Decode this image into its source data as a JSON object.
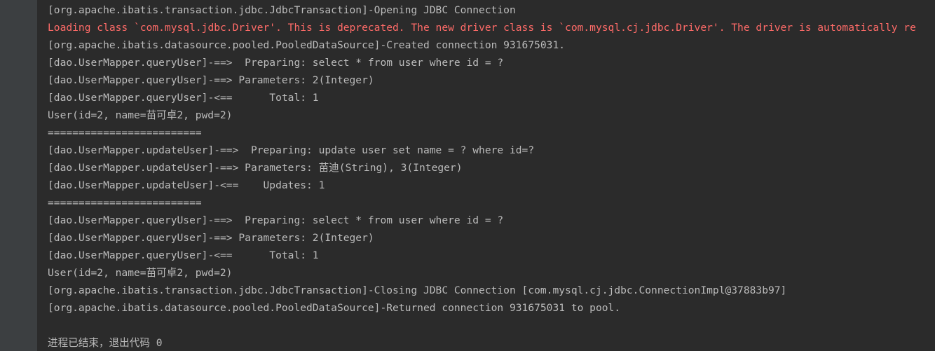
{
  "console": {
    "background_color": "#2b2b2b",
    "gutter_color": "#3c3f41",
    "info_color": "#bbbbbb",
    "error_color": "#ff6b68",
    "lines": [
      {
        "id": "line-opening-jdbc-connection",
        "type": "info",
        "text": "[org.apache.ibatis.transaction.jdbc.JdbcTransaction]-Opening JDBC Connection"
      },
      {
        "id": "line-driver-deprecated-warning",
        "type": "error",
        "text": "Loading class `com.mysql.jdbc.Driver'. This is deprecated. The new driver class is `com.mysql.cj.jdbc.Driver'. The driver is automatically re"
      },
      {
        "id": "line-created-connection",
        "type": "info",
        "text": "[org.apache.ibatis.datasource.pooled.PooledDataSource]-Created connection 931675031."
      },
      {
        "id": "line-query-preparing-1",
        "type": "info",
        "text": "[dao.UserMapper.queryUser]-==>  Preparing: select * from user where id = ?"
      },
      {
        "id": "line-query-parameters-1",
        "type": "info",
        "text": "[dao.UserMapper.queryUser]-==> Parameters: 2(Integer)"
      },
      {
        "id": "line-query-total-1",
        "type": "info",
        "text": "[dao.UserMapper.queryUser]-<==      Total: 1"
      },
      {
        "id": "line-user-result-1",
        "type": "info",
        "text": "User(id=2, name=苗可卓2, pwd=2)"
      },
      {
        "id": "line-separator-1",
        "type": "info",
        "text": "========================="
      },
      {
        "id": "line-update-preparing",
        "type": "info",
        "text": "[dao.UserMapper.updateUser]-==>  Preparing: update user set name = ? where id=?"
      },
      {
        "id": "line-update-parameters",
        "type": "info",
        "text": "[dao.UserMapper.updateUser]-==> Parameters: 苗迪(String), 3(Integer)"
      },
      {
        "id": "line-update-updates",
        "type": "info",
        "text": "[dao.UserMapper.updateUser]-<==    Updates: 1"
      },
      {
        "id": "line-separator-2",
        "type": "info",
        "text": "========================="
      },
      {
        "id": "line-query-preparing-2",
        "type": "info",
        "text": "[dao.UserMapper.queryUser]-==>  Preparing: select * from user where id = ?"
      },
      {
        "id": "line-query-parameters-2",
        "type": "info",
        "text": "[dao.UserMapper.queryUser]-==> Parameters: 2(Integer)"
      },
      {
        "id": "line-query-total-2",
        "type": "info",
        "text": "[dao.UserMapper.queryUser]-<==      Total: 1"
      },
      {
        "id": "line-user-result-2",
        "type": "info",
        "text": "User(id=2, name=苗可卓2, pwd=2)"
      },
      {
        "id": "line-closing-jdbc-connection",
        "type": "info",
        "text": "[org.apache.ibatis.transaction.jdbc.JdbcTransaction]-Closing JDBC Connection [com.mysql.cj.jdbc.ConnectionImpl@37883b97]"
      },
      {
        "id": "line-returned-connection",
        "type": "info",
        "text": "[org.apache.ibatis.datasource.pooled.PooledDataSource]-Returned connection 931675031 to pool."
      },
      {
        "id": "line-blank-1",
        "type": "blank",
        "text": " "
      },
      {
        "id": "line-process-finished",
        "type": "exit",
        "text": "进程已结束，退出代码 0"
      }
    ]
  }
}
